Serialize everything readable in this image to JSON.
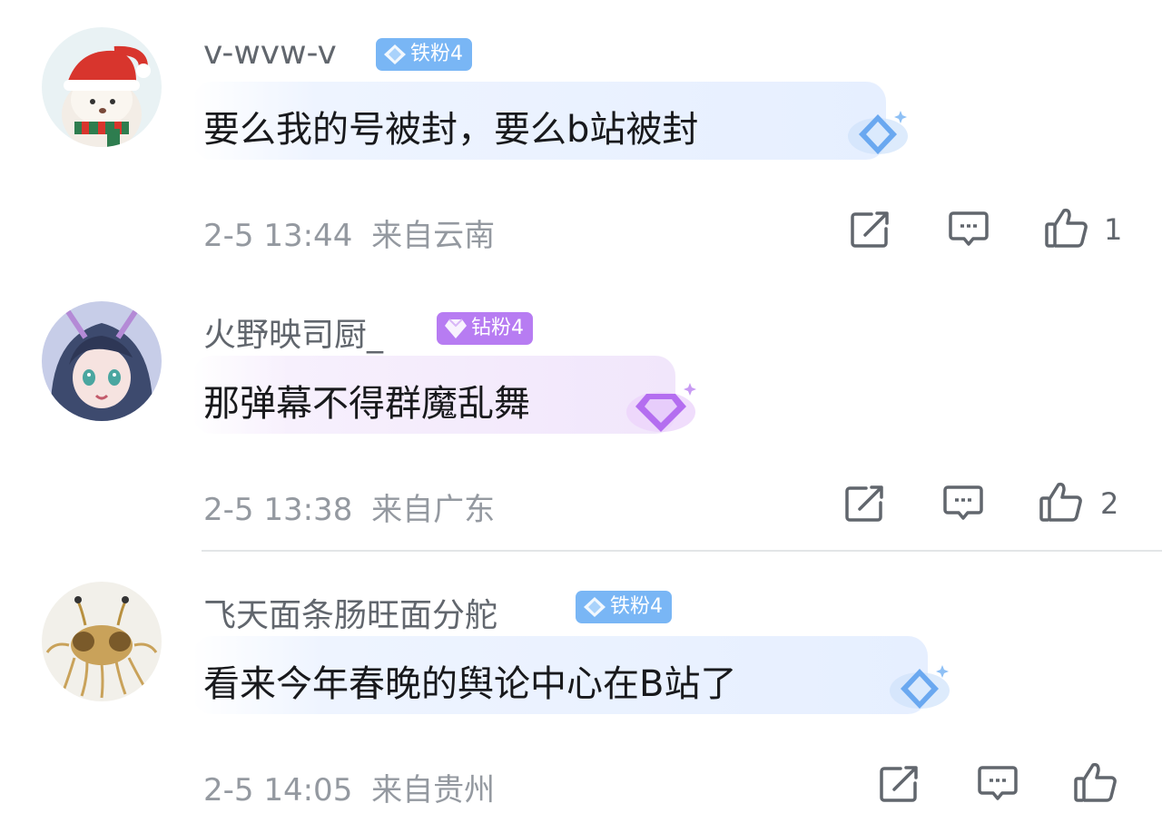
{
  "comments": [
    {
      "username": "v-wvw-v",
      "badge": "铁粉4",
      "badge_level": "iron",
      "content": "要么我的号被封，要么b站被封",
      "time": "2-5 13:44",
      "location": "来自云南",
      "likes": "1",
      "avatar": "santa-hat-plush-avatar"
    },
    {
      "username": "火野映司厨_",
      "badge": "钻粉4",
      "badge_level": "diamond",
      "content": "那弹幕不得群魔乱舞",
      "time": "2-5 13:38",
      "location": "来自广东",
      "likes": "2",
      "avatar": "anime-girl-avatar"
    },
    {
      "username": "飞天面条肠旺面分舵",
      "badge": "铁粉4",
      "badge_level": "iron",
      "content": "看来今年春晚的舆论中心在B站了",
      "time": "2-5 14:05",
      "location": "来自贵州",
      "likes": "",
      "avatar": "flying-spaghetti-monster-avatar"
    }
  ],
  "colors": {
    "iron_badge": "#79b6f5",
    "diamond_badge": "#b77cf2",
    "meta_text": "#9499a0",
    "username_text": "#61666d"
  },
  "icons": [
    "share-icon",
    "reply-icon",
    "like-icon",
    "gem-icon"
  ]
}
